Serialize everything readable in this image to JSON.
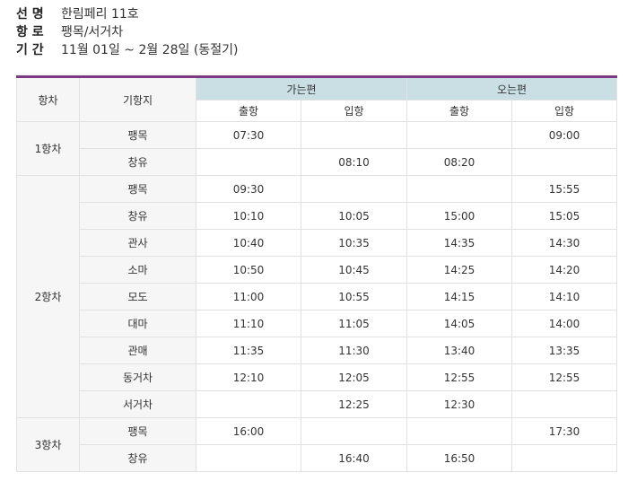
{
  "info": [
    {
      "key": "선 명",
      "value": "한림페리 11호"
    },
    {
      "key": "항 로",
      "value": "팽목/서거차"
    },
    {
      "key": "기 간",
      "value": "11월 01일 ~ 2월 28일 (동절기)"
    }
  ],
  "table": {
    "col_trip": "항차",
    "col_stop": "기항지",
    "group_outbound": "가는편",
    "group_return": "오는편",
    "sub_depart": "출항",
    "sub_arrive": "입항",
    "accent_color": "#7b3a82",
    "header_color": "#c9dfe4"
  },
  "trips": [
    {
      "label": "1항차",
      "rows": [
        {
          "stop": "팽목",
          "out_dep": "07:30",
          "out_arr": "",
          "ret_dep": "",
          "ret_arr": "09:00"
        },
        {
          "stop": "창유",
          "out_dep": "",
          "out_arr": "08:10",
          "ret_dep": "08:20",
          "ret_arr": ""
        }
      ]
    },
    {
      "label": "2항차",
      "rows": [
        {
          "stop": "팽목",
          "out_dep": "09:30",
          "out_arr": "",
          "ret_dep": "",
          "ret_arr": "15:55"
        },
        {
          "stop": "창유",
          "out_dep": "10:10",
          "out_arr": "10:05",
          "ret_dep": "15:00",
          "ret_arr": "15:05"
        },
        {
          "stop": "관사",
          "out_dep": "10:40",
          "out_arr": "10:35",
          "ret_dep": "14:35",
          "ret_arr": "14:30"
        },
        {
          "stop": "소마",
          "out_dep": "10:50",
          "out_arr": "10:45",
          "ret_dep": "14:25",
          "ret_arr": "14:20"
        },
        {
          "stop": "모도",
          "out_dep": "11:00",
          "out_arr": "10:55",
          "ret_dep": "14:15",
          "ret_arr": "14:10"
        },
        {
          "stop": "대마",
          "out_dep": "11:10",
          "out_arr": "11:05",
          "ret_dep": "14:05",
          "ret_arr": "14:00"
        },
        {
          "stop": "관매",
          "out_dep": "11:35",
          "out_arr": "11:30",
          "ret_dep": "13:40",
          "ret_arr": "13:35"
        },
        {
          "stop": "동거차",
          "out_dep": "12:10",
          "out_arr": "12:05",
          "ret_dep": "12:55",
          "ret_arr": "12:55"
        },
        {
          "stop": "서거차",
          "out_dep": "",
          "out_arr": "12:25",
          "ret_dep": "12:30",
          "ret_arr": ""
        }
      ]
    },
    {
      "label": "3항차",
      "rows": [
        {
          "stop": "팽목",
          "out_dep": "16:00",
          "out_arr": "",
          "ret_dep": "",
          "ret_arr": "17:30"
        },
        {
          "stop": "창유",
          "out_dep": "",
          "out_arr": "16:40",
          "ret_dep": "16:50",
          "ret_arr": ""
        }
      ]
    }
  ]
}
